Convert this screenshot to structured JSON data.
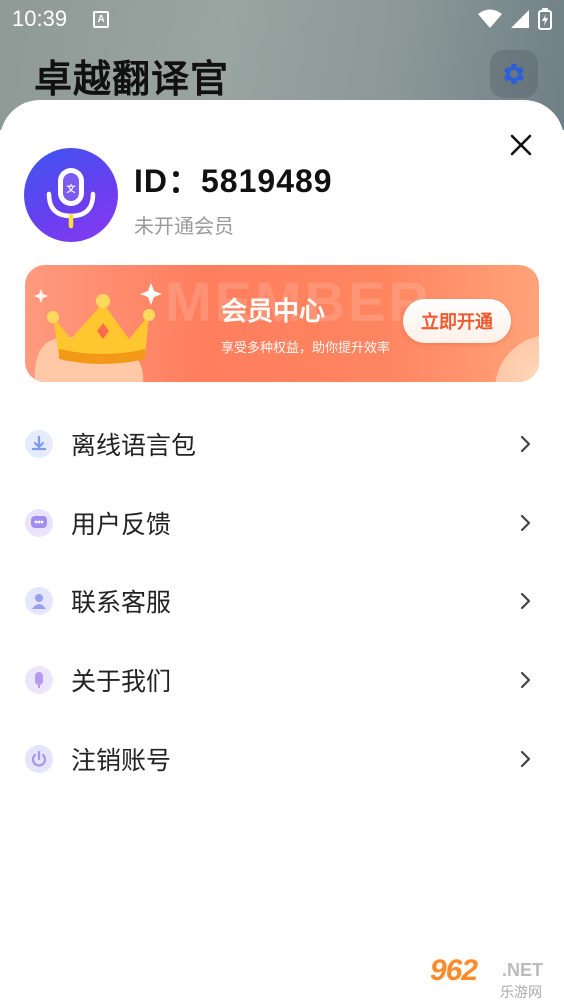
{
  "status_bar": {
    "time": "10:39",
    "notification_letter": "A"
  },
  "background_app": {
    "title": "卓越翻译官"
  },
  "profile": {
    "id_text": "ID：5819489",
    "member_status": "未开通会员"
  },
  "vip_banner": {
    "watermark": "MEMBER",
    "title": "会员中心",
    "subtitle": "享受多种权益，助你提升效率",
    "button_label": "立即开通"
  },
  "menu": {
    "items": [
      {
        "label": "离线语言包",
        "icon": "download-icon"
      },
      {
        "label": "用户反馈",
        "icon": "chat-icon"
      },
      {
        "label": "联系客服",
        "icon": "person-icon"
      },
      {
        "label": "关于我们",
        "icon": "mic-icon"
      },
      {
        "label": "注销账号",
        "icon": "power-icon"
      }
    ]
  },
  "watermark_logo": {
    "number": "962",
    "suffix": ".NET",
    "cn": "乐游网"
  },
  "colors": {
    "accent_blue": "#3f6bf0",
    "vip_orange": "#ff7e5e",
    "vip_button_text": "#f0592e"
  }
}
